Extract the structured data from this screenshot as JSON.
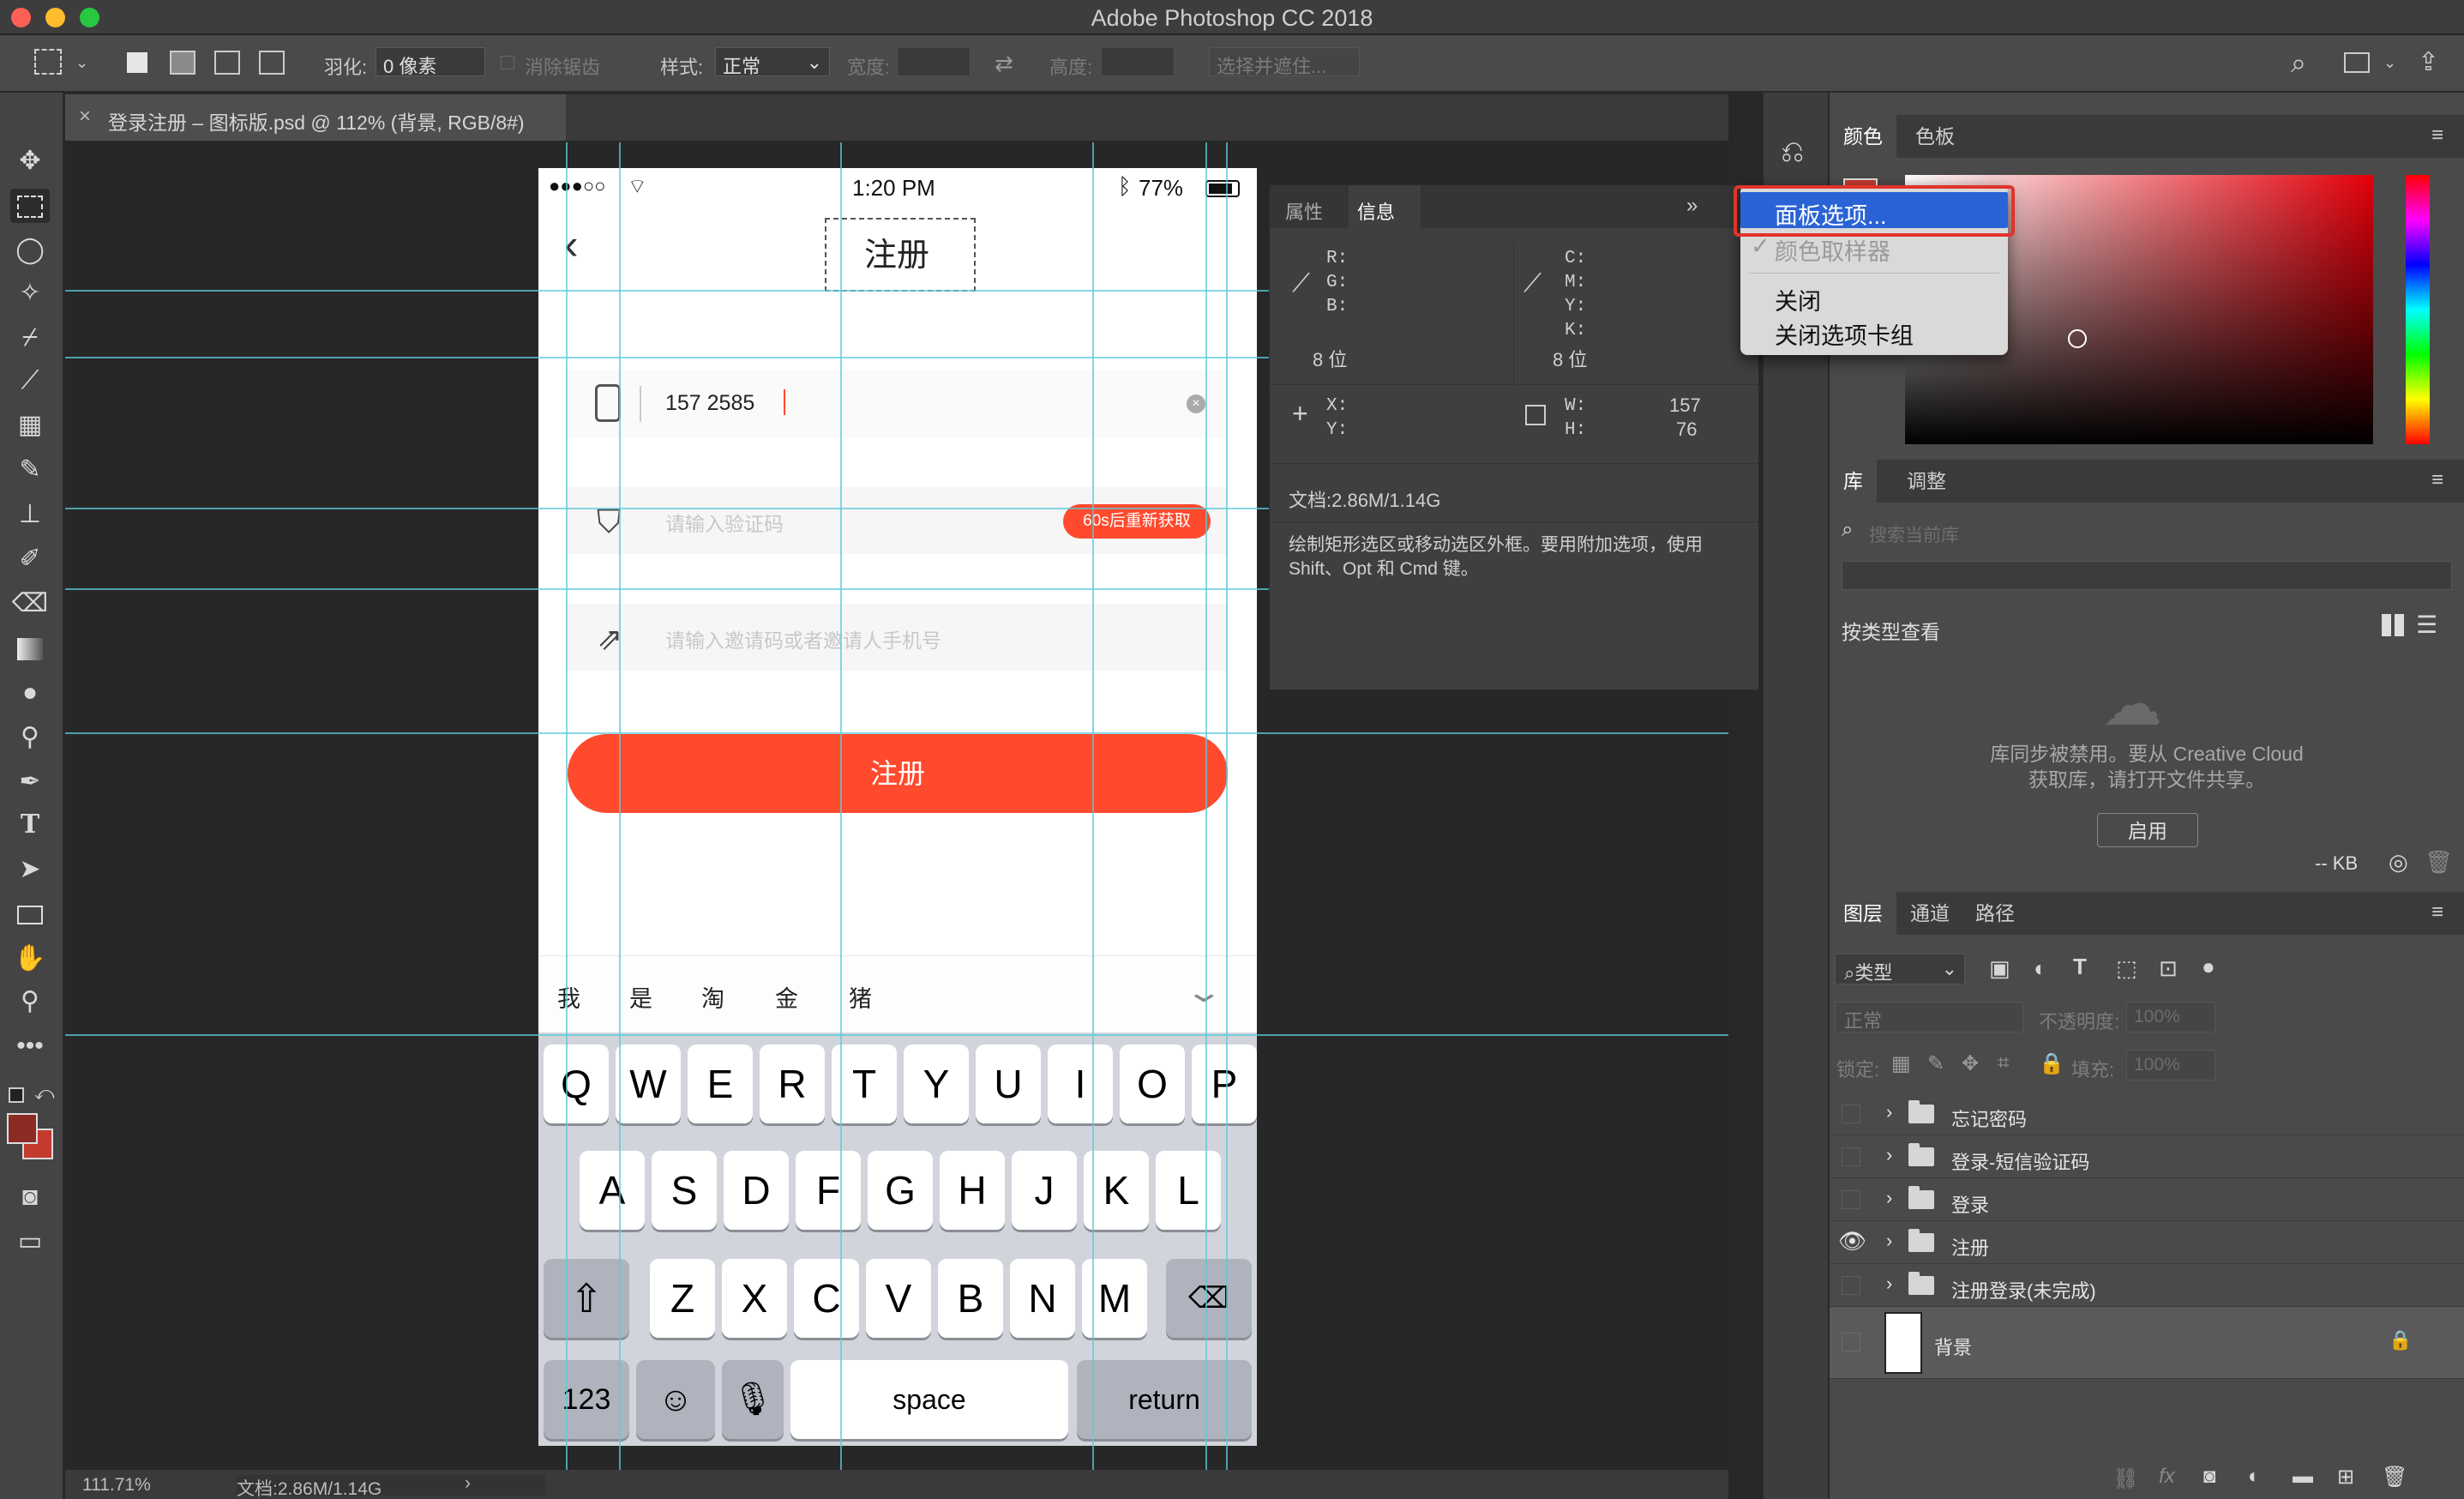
{
  "app": {
    "title": "Adobe Photoshop CC 2018"
  },
  "options_bar": {
    "feather_label": "羽化:",
    "feather_value": "0 像素",
    "antialias_label": "消除锯齿",
    "style_label": "样式:",
    "style_value": "正常",
    "width_label": "宽度:",
    "height_label": "高度:",
    "select_mask_label": "选择并遮住..."
  },
  "document": {
    "tab_title": "登录注册 – 图标版.psd @ 112% (背景, RGB/8#)",
    "zoom": "111.71%",
    "doc_size": "文档:2.86M/1.14G"
  },
  "phone": {
    "status": {
      "signal": "●●●○○",
      "time": "1:20 PM",
      "battery": "77%"
    },
    "title": "注册",
    "phone_value": "157 2585",
    "code_placeholder": "请输入验证码",
    "resend_label": "60s后重新获取",
    "invite_placeholder": "请输入邀请码或者邀请人手机号",
    "register_button": "注册",
    "candidates": [
      "我",
      "是",
      "淘",
      "金",
      "猪"
    ],
    "keys_row1": [
      "Q",
      "W",
      "E",
      "R",
      "T",
      "Y",
      "U",
      "I",
      "O",
      "P"
    ],
    "keys_row2": [
      "A",
      "S",
      "D",
      "F",
      "G",
      "H",
      "J",
      "K",
      "L"
    ],
    "keys_row3": [
      "Z",
      "X",
      "C",
      "V",
      "B",
      "N",
      "M"
    ],
    "key_123": "123",
    "key_space": "space",
    "key_return": "return"
  },
  "info_panel": {
    "tabs": [
      "属性",
      "信息"
    ],
    "rgb_labels": "R:\nG:\nB:",
    "cmyk_labels": "C:\nM:\nY:\nK:",
    "bits_left": "8 位",
    "bits_right": "8 位",
    "xy_labels": "X:\nY:",
    "wh_labels": "W:\nH:",
    "w_value": "157",
    "h_value": "76",
    "doc": "文档:2.86M/1.14G",
    "hint": "绘制矩形选区或移动选区外框。要用附加选项，使用 Shift、Opt 和 Cmd 键。"
  },
  "context_menu": {
    "items": [
      "面板选项...",
      "颜色取样器",
      "关闭",
      "关闭选项卡组"
    ]
  },
  "color_panel": {
    "tabs": [
      "颜色",
      "色板"
    ]
  },
  "library_panel": {
    "tabs": [
      "库",
      "调整"
    ],
    "search_placeholder": "搜索当前库",
    "view_by": "按类型查看",
    "disabled_msg_1": "库同步被禁用。要从 Creative Cloud",
    "disabled_msg_2": "获取库，请打开文件共享。",
    "enable_button": "启用",
    "size": "-- KB"
  },
  "layers_panel": {
    "tabs": [
      "图层",
      "通道",
      "路径"
    ],
    "filter_kind": "类型",
    "blend_mode": "正常",
    "opacity_label": "不透明度:",
    "opacity_value": "100%",
    "lock_label": "锁定:",
    "fill_label": "填充:",
    "fill_value": "100%",
    "layers": [
      "忘记密码",
      "登录-短信验证码",
      "登录",
      "注册",
      "注册登录(未完成)"
    ],
    "background_layer": "背景"
  },
  "colors": {
    "accent_red": "#ff4a2e",
    "menu_highlight": "#2a63d6",
    "guide": "#5ec9d8"
  }
}
